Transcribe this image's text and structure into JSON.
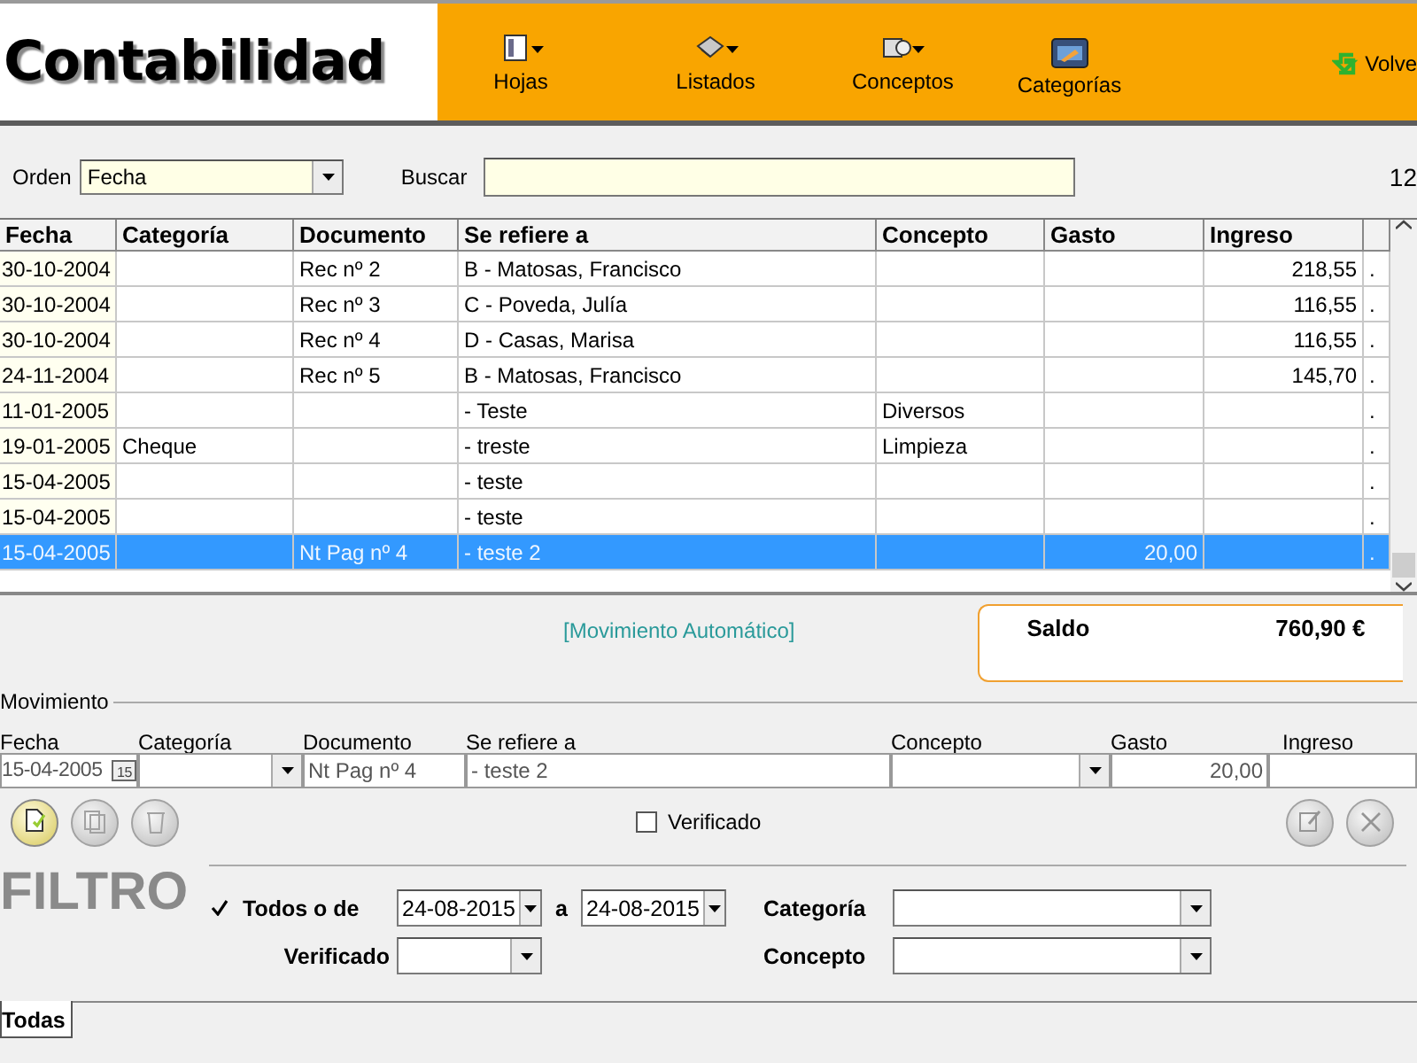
{
  "app_title": "Contabilidad",
  "toolbar": [
    {
      "label": "Hojas",
      "dropdown": true
    },
    {
      "label": "Listados",
      "dropdown": true
    },
    {
      "label": "Conceptos",
      "dropdown": true
    },
    {
      "label": "Categorías",
      "dropdown": false
    }
  ],
  "back_button": "Volve",
  "order": {
    "label": "Orden",
    "value": "Fecha"
  },
  "search": {
    "label": "Buscar"
  },
  "record_count": "12",
  "table": {
    "columns": [
      "Fecha",
      "Categoría",
      "Documento",
      "Se refiere a",
      "Concepto",
      "Gasto",
      "Ingreso"
    ],
    "rows": [
      {
        "fecha": "30-10-2004",
        "documento": "Rec nº 2",
        "refiere": "B - Matosas, Francisco",
        "ingreso": "218,55",
        "mark": ".",
        "selected": false
      },
      {
        "fecha": "30-10-2004",
        "documento": "Rec nº 3",
        "refiere": "C - Poveda, Julía",
        "ingreso": "116,55",
        "mark": ".",
        "selected": false
      },
      {
        "fecha": "30-10-2004",
        "documento": "Rec nº 4",
        "refiere": "D - Casas, Marisa",
        "ingreso": "116,55",
        "mark": ".",
        "selected": false
      },
      {
        "fecha": "24-11-2004",
        "documento": "Rec nº 5",
        "refiere": "B - Matosas, Francisco",
        "ingreso": "145,70",
        "mark": ".",
        "selected": false
      },
      {
        "fecha": "11-01-2005",
        "refiere": " - Teste",
        "concepto": "Diversos",
        "mark": ".",
        "selected": false
      },
      {
        "fecha": "19-01-2005",
        "categoria": "Cheque",
        "refiere": " - treste",
        "concepto": "Limpieza",
        "mark": ".",
        "selected": false
      },
      {
        "fecha": "15-04-2005",
        "refiere": " - teste",
        "mark": ".",
        "selected": false
      },
      {
        "fecha": "15-04-2005",
        "refiere": " - teste",
        "mark": ".",
        "selected": false
      },
      {
        "fecha": "15-04-2005",
        "documento": "Nt Pag nº 4",
        "refiere": " - teste 2",
        "gasto": "20,00",
        "mark": ".",
        "selected": true
      }
    ]
  },
  "auto_movement": "[Movimiento Automático]",
  "balance": {
    "label": "Saldo",
    "value": "760,90 €"
  },
  "movement": {
    "title": "Movimiento",
    "fields": [
      {
        "label": "Fecha",
        "kind": "date",
        "value": "15-04-2005"
      },
      {
        "label": "Categoría",
        "kind": "combo"
      },
      {
        "label": "Documento",
        "kind": "text",
        "value": "Nt Pag nº 4"
      },
      {
        "label": "Se refiere a",
        "kind": "text",
        "value": "- teste 2"
      },
      {
        "label": "Concepto",
        "kind": "combo"
      },
      {
        "label": "Gasto",
        "kind": "number",
        "value": "20,00"
      },
      {
        "label": "Ingreso",
        "kind": "number"
      }
    ]
  },
  "date_icon": "15",
  "left_actions": [
    {
      "disabled": false
    },
    {
      "disabled": true
    },
    {
      "disabled": true
    }
  ],
  "verified": {
    "label": "Verificado",
    "checked": false
  },
  "right_actions": [
    {
      "disabled": true
    },
    {
      "disabled": true
    }
  ],
  "filter": {
    "title": "FILTRO",
    "all": {
      "label": "Todos o de",
      "checked": true
    },
    "from": "24-08-2015",
    "to_label": "a",
    "to": "24-08-2015",
    "category_label": "Categoría",
    "verified_label": "Verificado",
    "concept_label": "Concepto"
  },
  "tabs": [
    {
      "label": "Todas",
      "selected": true
    }
  ]
}
